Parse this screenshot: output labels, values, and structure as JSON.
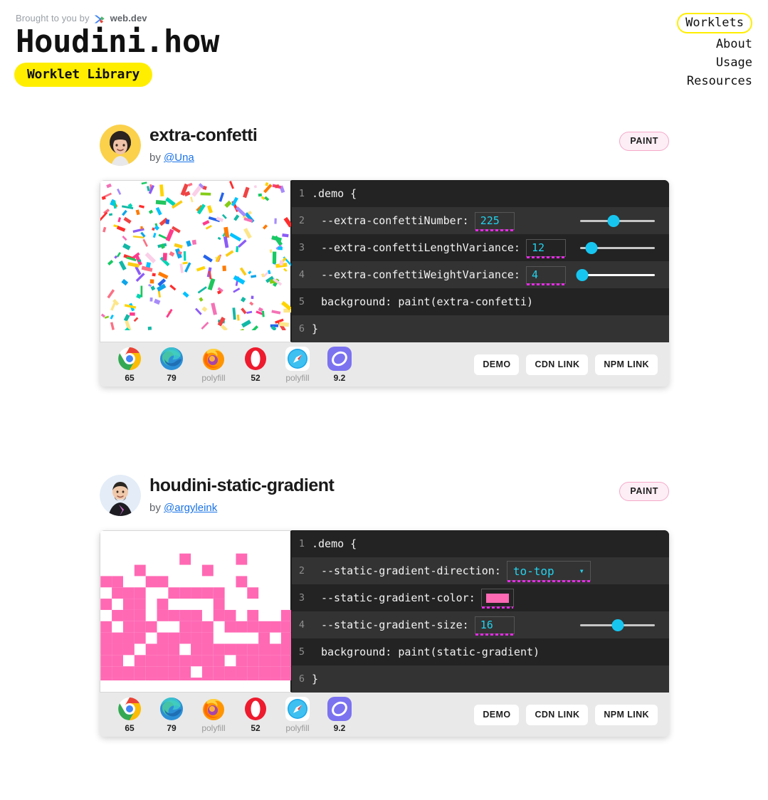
{
  "header": {
    "brought_prefix": "Brought to you by",
    "brought_brand": "web.dev",
    "brought_icon": "webdev-logo-icon",
    "title": "Houdini.how",
    "subtitle": "Worklet Library"
  },
  "nav": {
    "items": [
      {
        "label": "Worklets",
        "active": true
      },
      {
        "label": "About",
        "active": false
      },
      {
        "label": "Usage",
        "active": false
      },
      {
        "label": "Resources",
        "active": false
      }
    ]
  },
  "colors": {
    "accent_yellow": "#ffee00",
    "link_blue": "#1a73e8",
    "code_value_cyan": "#22d3ee",
    "dotted_magenta": "#e829e8",
    "slider_thumb": "#16c6f0",
    "badge_bg": "#fdeef5",
    "badge_border": "#f4a8c8",
    "swatch_pink": "#ff69b4",
    "code_bg_odd": "#232323",
    "code_bg_even": "#333333",
    "card_bg": "#e9e9e9"
  },
  "buttons": {
    "demo": "DEMO",
    "cdn": "CDN LINK",
    "npm": "NPM LINK"
  },
  "browsers": [
    {
      "name": "chrome",
      "version": "65",
      "polyfill": false
    },
    {
      "name": "edge",
      "version": "79",
      "polyfill": false
    },
    {
      "name": "firefox",
      "version": "polyfill",
      "polyfill": true
    },
    {
      "name": "opera",
      "version": "52",
      "polyfill": false
    },
    {
      "name": "safari",
      "version": "polyfill",
      "polyfill": true
    },
    {
      "name": "samsung-internet",
      "version": "9.2",
      "polyfill": false
    }
  ],
  "worklets": [
    {
      "name": "extra-confetti",
      "by_prefix": "by",
      "author": "@Una",
      "badge": "PAINT",
      "preview_type": "confetti",
      "code": {
        "line1_num": "1",
        "line1_text": ".demo {",
        "line5_num": "5",
        "line5_text": "background: paint(extra-confetti)",
        "line6_num": "6",
        "line6_text": "}",
        "props": [
          {
            "num": "2",
            "name": "--extra-confettiNumber:",
            "value": "225",
            "control": "slider",
            "slider_pct": 45
          },
          {
            "num": "3",
            "name": "--extra-confettiLengthVariance:",
            "value": "12",
            "control": "slider",
            "slider_pct": 15
          },
          {
            "num": "4",
            "name": "--extra-confettiWeightVariance:",
            "value": "4",
            "control": "slider",
            "slider_pct": 7
          }
        ]
      }
    },
    {
      "name": "houdini-static-gradient",
      "by_prefix": "by",
      "author": "@argyleink",
      "badge": "PAINT",
      "preview_type": "pixel-gradient",
      "code": {
        "line1_num": "1",
        "line1_text": ".demo {",
        "line5_num": "5",
        "line5_text": "background: paint(static-gradient)",
        "line6_num": "6",
        "line6_text": "}",
        "props": [
          {
            "num": "2",
            "name": "--static-gradient-direction:",
            "value": "to-top",
            "control": "select"
          },
          {
            "num": "3",
            "name": "--static-gradient-color:",
            "value": "#ff69b4",
            "control": "color"
          },
          {
            "num": "4",
            "name": "--static-gradient-size:",
            "value": "16",
            "control": "slider",
            "slider_pct": 50
          }
        ]
      }
    }
  ]
}
